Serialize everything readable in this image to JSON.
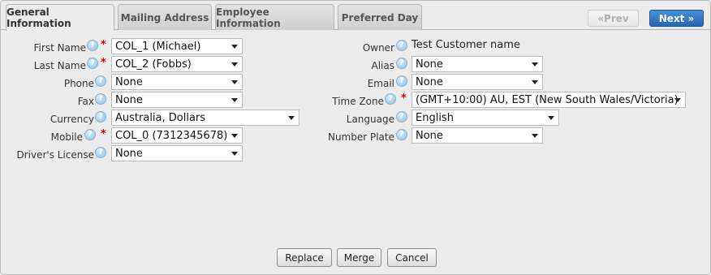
{
  "tabs": [
    {
      "label": "General Information"
    },
    {
      "label": "Mailing Address"
    },
    {
      "label": "Employee Information"
    },
    {
      "label": "Preferred Day"
    }
  ],
  "nav": {
    "prev": "«Prev",
    "next": "Next »"
  },
  "left_fields": {
    "first_name": {
      "label": "First Name",
      "value": "COL_1 (Michael)",
      "required": "*"
    },
    "last_name": {
      "label": "Last Name",
      "value": "COL_2 (Fobbs)",
      "required": "*"
    },
    "phone": {
      "label": "Phone",
      "value": "None"
    },
    "fax": {
      "label": "Fax",
      "value": "None"
    },
    "currency": {
      "label": "Currency",
      "value": "Australia, Dollars"
    },
    "mobile": {
      "label": "Mobile",
      "value": "COL_0 (7312345678)",
      "required": "*"
    },
    "drivers_license": {
      "label": "Driver's License",
      "value": "None"
    }
  },
  "right_fields": {
    "owner": {
      "label": "Owner",
      "value": "Test Customer name"
    },
    "alias": {
      "label": "Alias",
      "value": "None"
    },
    "email": {
      "label": "Email",
      "value": "None"
    },
    "time_zone": {
      "label": "Time Zone",
      "value": "(GMT+10:00) AU, EST (New South Wales/Victoria)",
      "required": "*"
    },
    "language": {
      "label": "Language",
      "value": "English"
    },
    "number_plate": {
      "label": "Number Plate",
      "value": "None"
    }
  },
  "help_glyph": "?",
  "actions": {
    "replace": "Replace",
    "merge": "Merge",
    "cancel": "Cancel"
  },
  "icons": {
    "help": "help-icon",
    "dropdown": "chevron-down-icon"
  },
  "colors": {
    "required": "#d40000",
    "next_button": "#2667b5",
    "help_icon": "#8ec0e6"
  }
}
